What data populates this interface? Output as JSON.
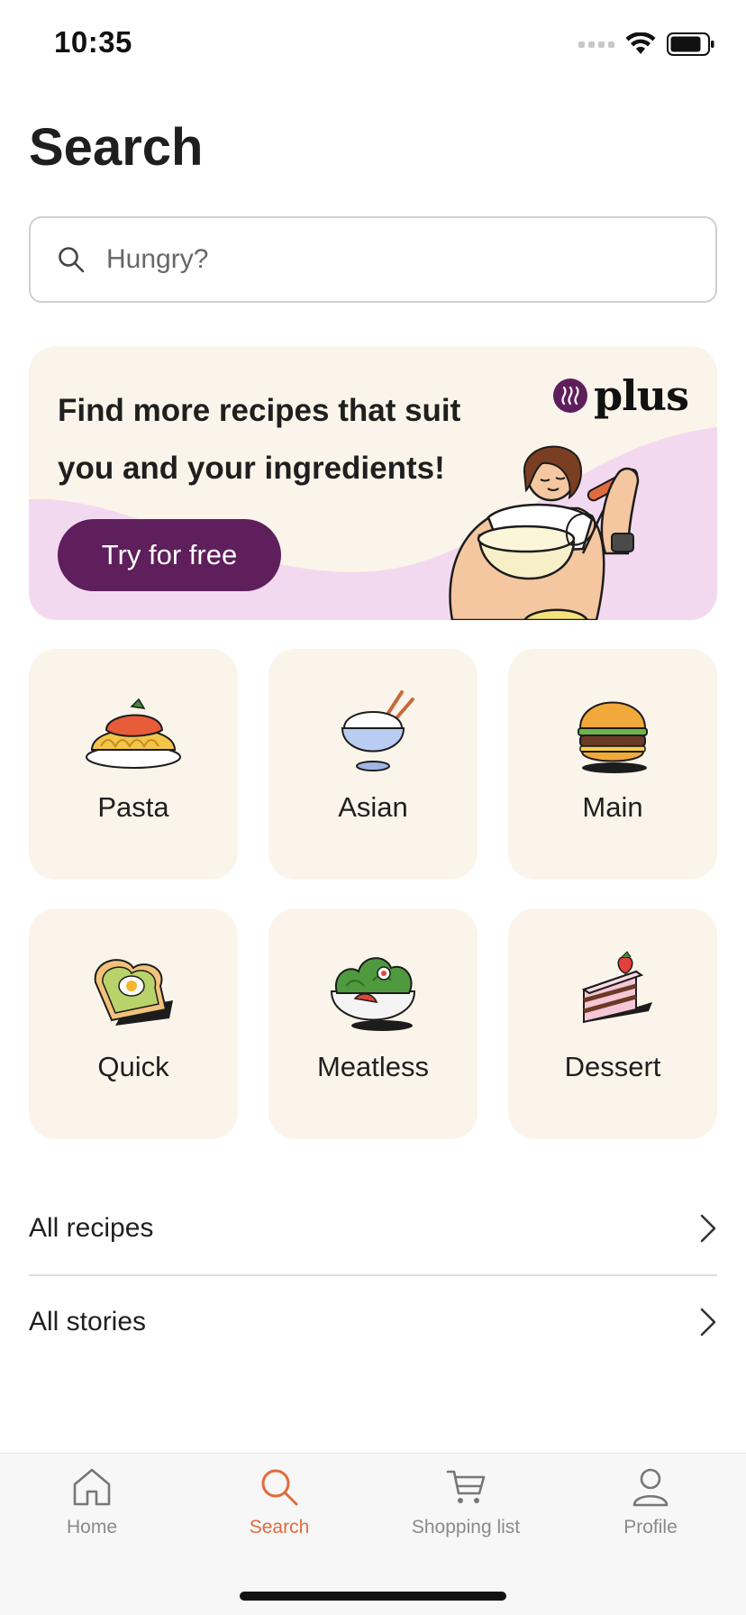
{
  "status_bar": {
    "time": "10:35"
  },
  "header": {
    "title": "Search"
  },
  "search": {
    "placeholder": "Hungry?"
  },
  "promo": {
    "text": "Find more recipes that suit you and your ingredients!",
    "button_label": "Try for free",
    "logo_text": "plus",
    "colors": {
      "background": "#fbf4ea",
      "wave": "#f3d9ef",
      "button": "#5e1f5c"
    }
  },
  "categories": [
    {
      "label": "Pasta",
      "icon": "pasta-icon"
    },
    {
      "label": "Asian",
      "icon": "rice-bowl-icon"
    },
    {
      "label": "Main",
      "icon": "burger-icon"
    },
    {
      "label": "Quick",
      "icon": "toast-icon"
    },
    {
      "label": "Meatless",
      "icon": "salad-icon"
    },
    {
      "label": "Dessert",
      "icon": "cake-icon"
    }
  ],
  "links": [
    {
      "label": "All recipes"
    },
    {
      "label": "All stories"
    }
  ],
  "tab_bar": {
    "active": "Search",
    "accent_color": "#e06b3e",
    "tabs": [
      {
        "label": "Home",
        "icon": "home-icon"
      },
      {
        "label": "Search",
        "icon": "search-icon"
      },
      {
        "label": "Shopping list",
        "icon": "cart-icon"
      },
      {
        "label": "Profile",
        "icon": "profile-icon"
      }
    ]
  }
}
